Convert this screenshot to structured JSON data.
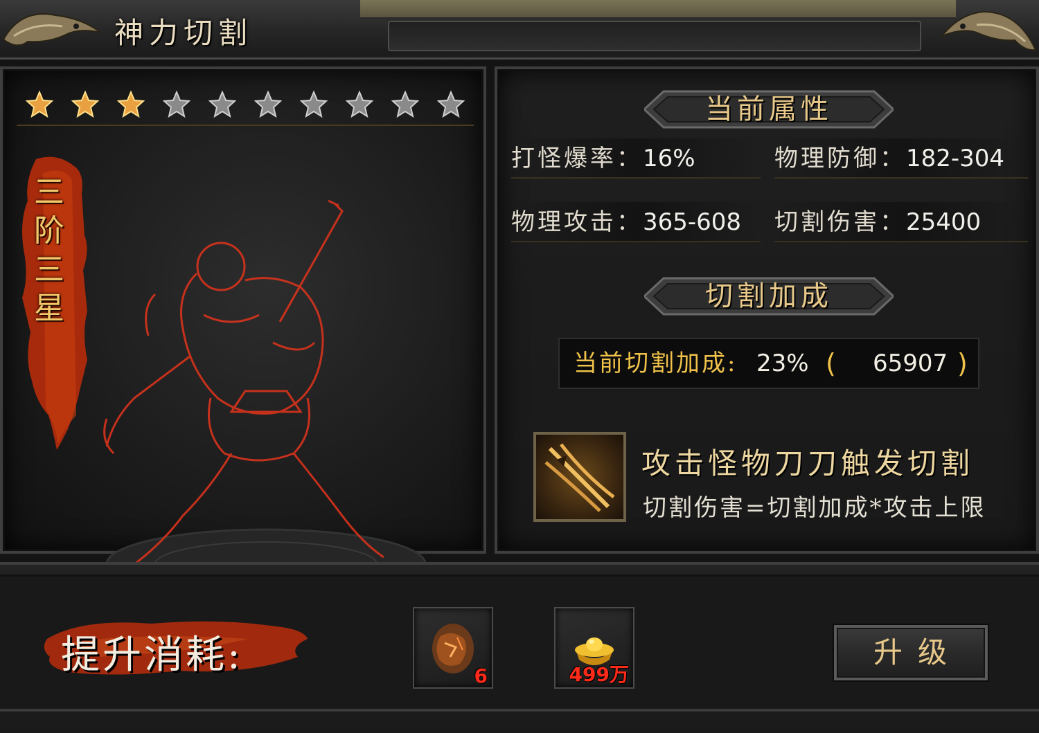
{
  "window": {
    "title": "神力切割"
  },
  "stars": {
    "total": 10,
    "filled": 3
  },
  "rank": {
    "chars": [
      "三",
      "阶",
      "三",
      "星"
    ]
  },
  "attributes": {
    "title": "当前属性",
    "items": [
      {
        "label": "打怪爆率：",
        "value": "16%"
      },
      {
        "label": "物理防御：",
        "value": "182-304"
      },
      {
        "label": "物理攻击：",
        "value": "365-608"
      },
      {
        "label": "切割伤害：",
        "value": "25400"
      }
    ]
  },
  "bonus": {
    "title": "切割加成",
    "label": "当前切割加成:",
    "percent": "23%",
    "paren_open": "(",
    "paren_close": ")",
    "value": "65907"
  },
  "skill": {
    "icon": "claw-slash-icon",
    "title": "攻击怪物刀刀触发切割",
    "description": "切割伤害=切割加成*攻击上限"
  },
  "cost": {
    "label": "提升消耗:",
    "items": [
      {
        "icon": "ore-stone-icon",
        "qty": "6"
      },
      {
        "icon": "gold-ingot-icon",
        "qty": "499万"
      }
    ]
  },
  "upgrade_button": {
    "label": "升级"
  },
  "colors": {
    "gold_text": "#f0c24a",
    "star_gold": "#e8a040",
    "qty_red": "#ff2a1a",
    "banner_red": "#b8300e"
  }
}
